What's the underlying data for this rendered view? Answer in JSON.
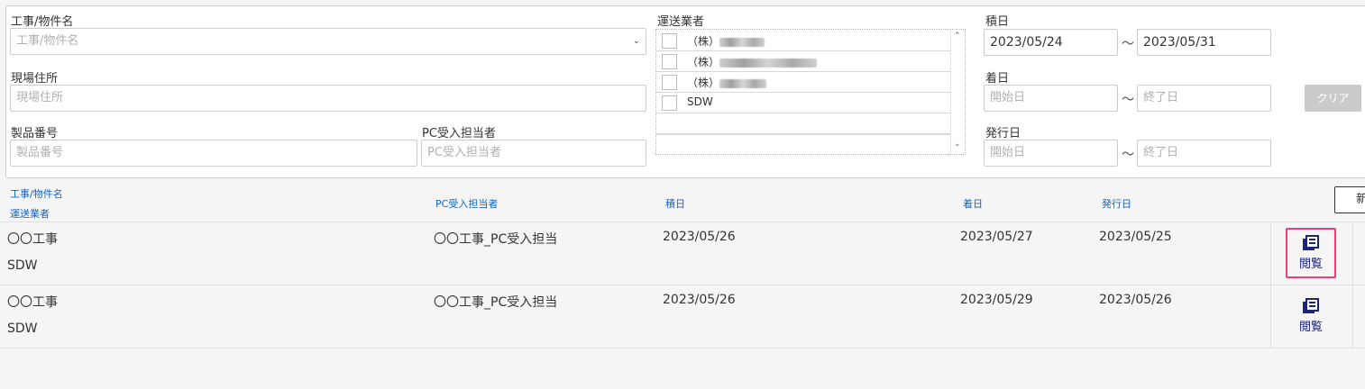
{
  "filters": {
    "project": {
      "label": "工事/物件名",
      "placeholder": "工事/物件名"
    },
    "site_address": {
      "label": "現場住所",
      "placeholder": "現場住所"
    },
    "product_no": {
      "label": "製品番号",
      "placeholder": "製品番号"
    },
    "pc_receiver": {
      "label": "PC受入担当者",
      "placeholder": "PC受入担当者"
    },
    "carrier": {
      "label": "運送業者",
      "options": [
        "（株）",
        "（株）",
        "（株）",
        "SDW"
      ]
    },
    "loading_date": {
      "label": "積日",
      "from": "2023/05/24",
      "to": "2023/05/31"
    },
    "arrival_date": {
      "label": "着日",
      "from_placeholder": "開始日",
      "to_placeholder": "終了日"
    },
    "issue_date": {
      "label": "発行日",
      "from_placeholder": "開始日",
      "to_placeholder": "終了日"
    },
    "range_sep": "～",
    "clear_label": "クリア"
  },
  "table": {
    "headers": {
      "project": "工事/物件名",
      "carrier": "運送業者",
      "pc_receiver": "PC受入担当者",
      "loading": "積日",
      "arrival": "着日",
      "issued": "発行日"
    },
    "new_label": "新",
    "rows": [
      {
        "project": "〇〇工事",
        "carrier": "SDW",
        "pc_receiver": "〇〇工事_PC受入担当",
        "loading": "2023/05/26",
        "arrival": "2023/05/27",
        "issued": "2023/05/25",
        "view": "閲覧"
      },
      {
        "project": "〇〇工事",
        "carrier": "SDW",
        "pc_receiver": "〇〇工事_PC受入担当",
        "loading": "2023/05/26",
        "arrival": "2023/05/29",
        "issued": "2023/05/26",
        "view": "閲覧"
      }
    ]
  },
  "icons": {
    "view": "document-stack-icon",
    "select": "chevron-down-icon"
  },
  "colors": {
    "header_link": "#1565c0",
    "highlight": "#ec407a",
    "view_icon": "#1a237e",
    "clear_bg": "#cbcbcb"
  }
}
